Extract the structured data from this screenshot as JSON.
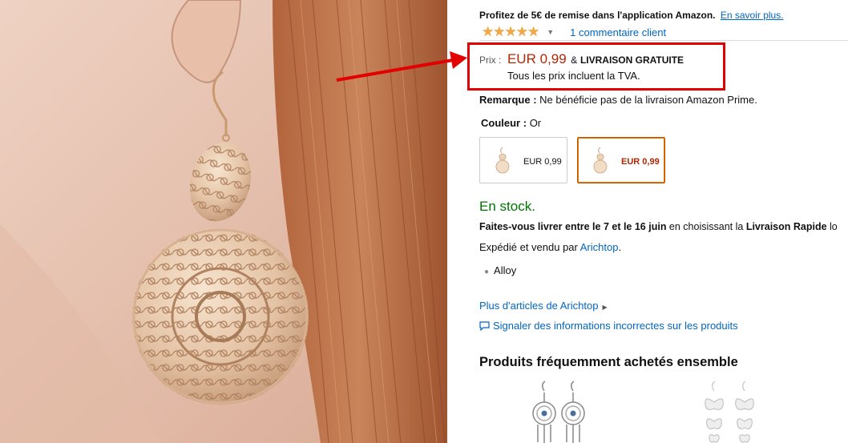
{
  "photo": {
    "alt": ""
  },
  "promo": {
    "text": "Profitez de 5€ de remise dans l'application Amazon.",
    "link": "En savoir plus."
  },
  "rating": {
    "stars": "★★★★★",
    "reviews": "1 commentaire client"
  },
  "price": {
    "label": "Prix :",
    "value": "EUR 0,99",
    "amp": "&",
    "shipping": "LIVRAISON GRATUITE",
    "vat": "Tous les prix incluent la TVA."
  },
  "remark": {
    "label": "Remarque :",
    "text": "Ne bénéficie pas de la livraison Amazon Prime."
  },
  "color": {
    "label": "Couleur :",
    "value": "Or"
  },
  "swatches": [
    {
      "price": "EUR 0,99",
      "selected": false
    },
    {
      "price": "EUR 0,99",
      "selected": true
    }
  ],
  "stock": "En stock.",
  "delivery": {
    "pre": "Faites-vous livrer entre le ",
    "d1": "7",
    "mid": " et le ",
    "d2": "16 juin",
    "post": " en choisissant la ",
    "opt": "Livraison Rapide",
    "tail": " lo"
  },
  "sold": {
    "text": "Expédié et vendu par ",
    "seller": "Arichtop",
    "end": "."
  },
  "features": [
    "Alloy"
  ],
  "more_link": "Plus d'articles de Arichtop",
  "report_link": "Signaler des informations incorrectes sur les produits",
  "fbt_title": "Produits fréquemment achetés ensemble",
  "colors": {
    "price": "#B12704",
    "link": "#0066C0",
    "stock": "#007600",
    "highlight": "#E30000",
    "star": "#F3A847"
  }
}
